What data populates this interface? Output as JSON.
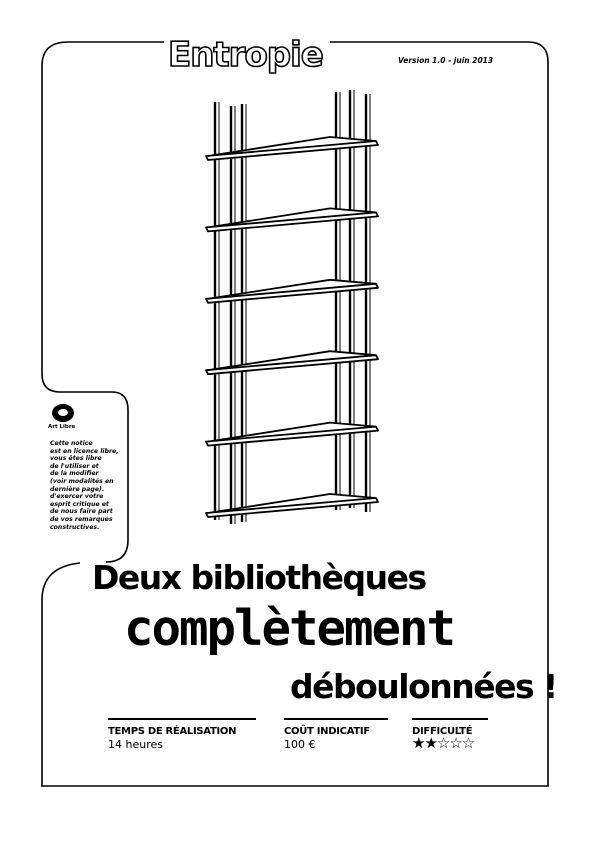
{
  "header": {
    "logo_text": "Entropie",
    "version": "Version 1.0 - juin 2013"
  },
  "sidebar_notice": {
    "badge_label": "Art Libre",
    "lines": [
      "Cette notice",
      "est en licence libre,",
      "vous êtes libre",
      "de l'utiliser et",
      "de la modifier",
      "(voir modalités en",
      "dernière page).",
      "d'exercer votre",
      "esprit critique et",
      "de nous faire part",
      "de vos remarques",
      "constructives."
    ]
  },
  "title": {
    "line1": "Deux bibliothèques",
    "line2": "complètement",
    "line3": "déboulonnées !"
  },
  "info": {
    "time_label": "TEMPS DE RÉALISATION",
    "time_value": "14 heures",
    "cost_label": "COÛT INDICATIF",
    "cost_value": "100 €",
    "difficulty_label": "DIFFICULTÉ",
    "difficulty_stars": "★★☆☆☆",
    "difficulty_rating": 2,
    "difficulty_max": 5
  },
  "illustration": {
    "name": "bookshelf-drawing",
    "shelf_count": 6
  }
}
